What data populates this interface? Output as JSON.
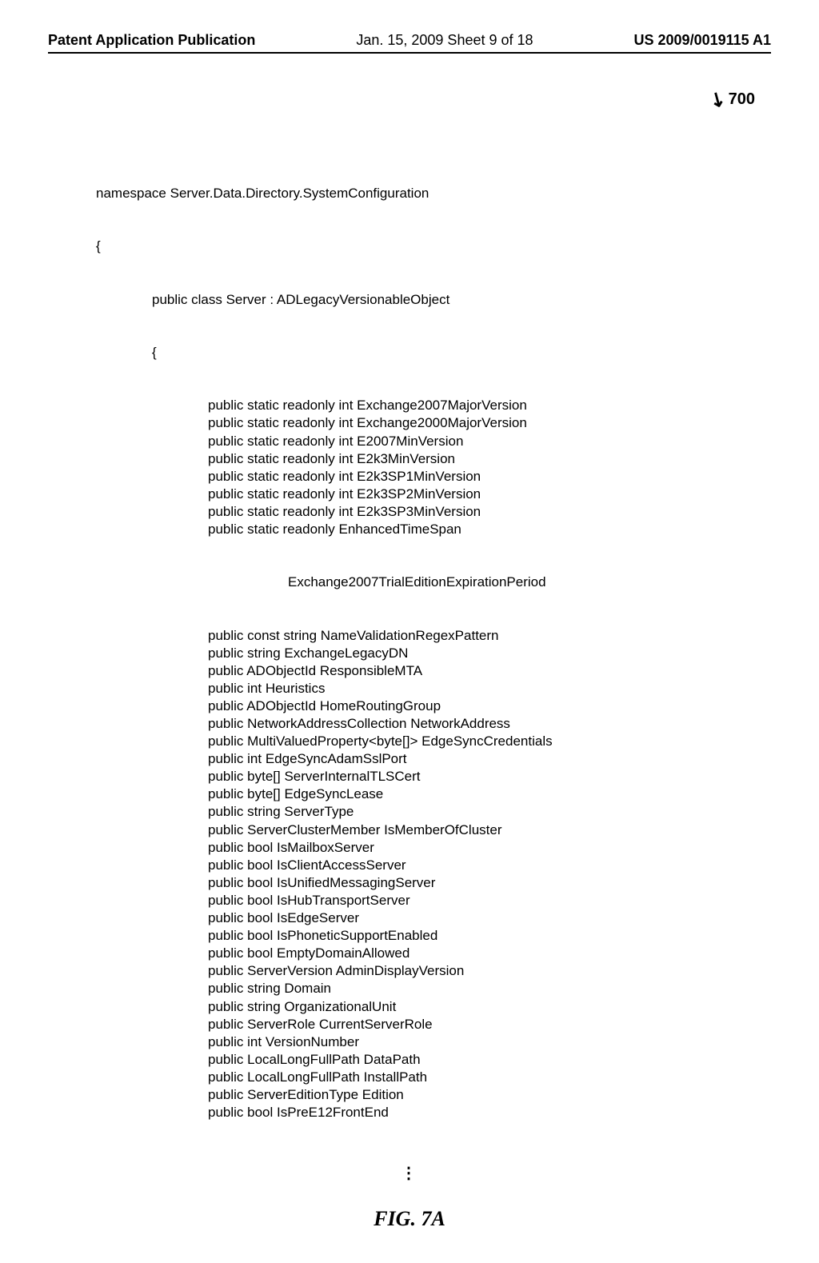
{
  "header": {
    "left": "Patent Application Publication",
    "center": "Jan. 15, 2009  Sheet 9 of 18",
    "right": "US 2009/0019115 A1"
  },
  "figure_ref": "700",
  "code": {
    "namespace_line": "namespace Server.Data.Directory.SystemConfiguration",
    "brace_open_0": "{",
    "class_line": "public class Server : ADLegacyVersionableObject",
    "brace_open_1": "{",
    "members": [
      "public static readonly int Exchange2007MajorVersion",
      "public static readonly int Exchange2000MajorVersion",
      "public static readonly int E2007MinVersion",
      "public static readonly int E2k3MinVersion",
      "public static readonly int E2k3SP1MinVersion",
      "public static readonly int E2k3SP2MinVersion",
      "public static readonly int E2k3SP3MinVersion",
      "public static readonly EnhancedTimeSpan"
    ],
    "continuation_line": "Exchange2007TrialEditionExpirationPeriod",
    "members2": [
      "public const string NameValidationRegexPattern",
      "public string ExchangeLegacyDN",
      "public ADObjectId ResponsibleMTA",
      "public int Heuristics",
      "public ADObjectId HomeRoutingGroup",
      "public NetworkAddressCollection NetworkAddress",
      "public MultiValuedProperty<byte[]> EdgeSyncCredentials",
      "public int EdgeSyncAdamSslPort",
      "public byte[] ServerInternalTLSCert",
      "public byte[] EdgeSyncLease",
      "public string ServerType",
      "public ServerClusterMember IsMemberOfCluster",
      "public bool IsMailboxServer",
      "public bool IsClientAccessServer",
      "public bool IsUnifiedMessagingServer",
      "public bool IsHubTransportServer",
      "public bool IsEdgeServer",
      "public bool IsPhoneticSupportEnabled",
      "public bool EmptyDomainAllowed",
      "public ServerVersion AdminDisplayVersion",
      "public string Domain",
      "public string OrganizationalUnit",
      "public ServerRole CurrentServerRole",
      "public int VersionNumber",
      "public LocalLongFullPath DataPath",
      "public LocalLongFullPath InstallPath",
      "public ServerEditionType Edition",
      "public bool IsPreE12FrontEnd"
    ]
  },
  "continuation_dots": "⋮",
  "figure_caption": {
    "label": "FIG.",
    "number": "7A"
  }
}
